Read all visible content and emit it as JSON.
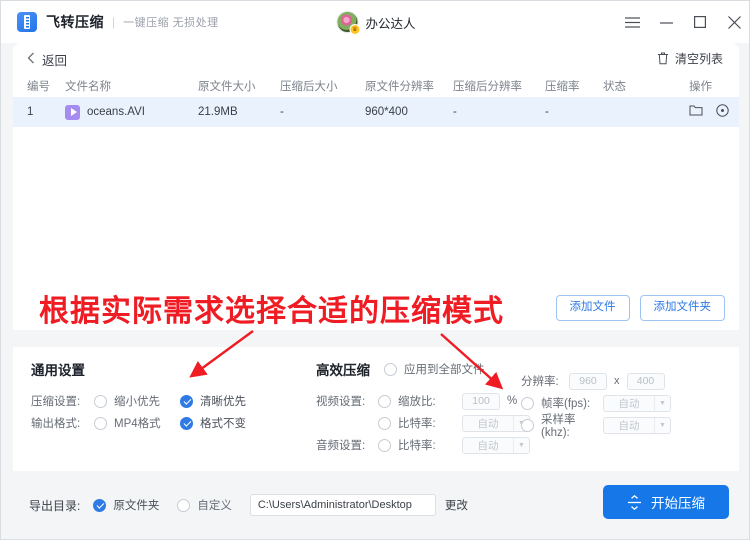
{
  "titlebar": {
    "logo_icon": "compress-app-logo",
    "app_title": "飞转压缩",
    "separator": "|",
    "subtitle": "一键压缩 无损处理",
    "user_name": "办公达人",
    "vip_badge": "♛",
    "menu_icon": "hamburger-menu-icon",
    "minimize_icon": "minimize-icon",
    "maximize_icon": "maximize-icon",
    "close_icon": "close-icon"
  },
  "toolbar": {
    "back_icon": "chevron-left-icon",
    "back_label": "返回",
    "trash_icon": "trash-icon",
    "clear_label": "清空列表"
  },
  "table": {
    "columns": [
      "编号",
      "文件名称",
      "原文件大小",
      "压缩后大小",
      "原文件分辨率",
      "压缩后分辨率",
      "压缩率",
      "状态",
      "操作"
    ],
    "rows": [
      {
        "no": "1",
        "file_icon": "video-file-icon",
        "name": "oceans.AVI",
        "original_size": "21.9MB",
        "compressed_size": "-",
        "original_resolution": "960*400",
        "compressed_resolution": "-",
        "ratio": "-",
        "status": "",
        "action_open_icon": "folder-open-icon",
        "action_remove_icon": "remove-circle-icon"
      }
    ]
  },
  "add_buttons": {
    "add_file": "添加文件",
    "add_folder": "添加文件夹"
  },
  "general_settings": {
    "title": "通用设置",
    "compress_label": "压缩设置:",
    "compress_options": [
      {
        "label": "缩小优先",
        "selected": false
      },
      {
        "label": "清晰优先",
        "selected": true
      }
    ],
    "format_label": "输出格式:",
    "format_options": [
      {
        "label": "MP4格式",
        "selected": false
      },
      {
        "label": "格式不变",
        "selected": true
      }
    ]
  },
  "efficient_settings": {
    "title": "高效压缩",
    "apply_all_label": "应用到全部文件",
    "apply_all_selected": false,
    "video_label": "视频设置:",
    "audio_label": "音频设置:",
    "scale_label": "缩放比:",
    "scale_value": "100",
    "percent_sign": "%",
    "video_bitrate_label": "比特率:",
    "video_bitrate_value": "自动",
    "audio_bitrate_label": "比特率:",
    "audio_bitrate_value": "自动",
    "resolution_label": "分辨率:",
    "resolution_width": "960",
    "resolution_sep": "x",
    "resolution_height": "400",
    "fps_label": "帧率(fps):",
    "fps_value": "自动",
    "sample_label": "采样率(khz):",
    "sample_value": "自动",
    "dropdown_icon": "chevron-down-icon"
  },
  "bottom": {
    "export_label": "导出目录:",
    "export_options": [
      {
        "label": "原文件夹",
        "selected": true
      },
      {
        "label": "自定义",
        "selected": false
      }
    ],
    "path_value": "C:\\Users\\Administrator\\Desktop",
    "change_label": "更改",
    "start_icon": "compress-arrows-icon",
    "start_label": "开始压缩"
  },
  "annotation": {
    "text": "根据实际需求选择合适的压缩模式",
    "color": "#ef1c24",
    "arrow_left": "arrow-pointing-to-clarity-priority",
    "arrow_right": "arrow-pointing-to-resolution"
  },
  "colors": {
    "accent": "#1678e8",
    "radio_on": "#2f7ae5",
    "row_highlight": "#eaf3fd",
    "annotation_red": "#ef1c24"
  }
}
